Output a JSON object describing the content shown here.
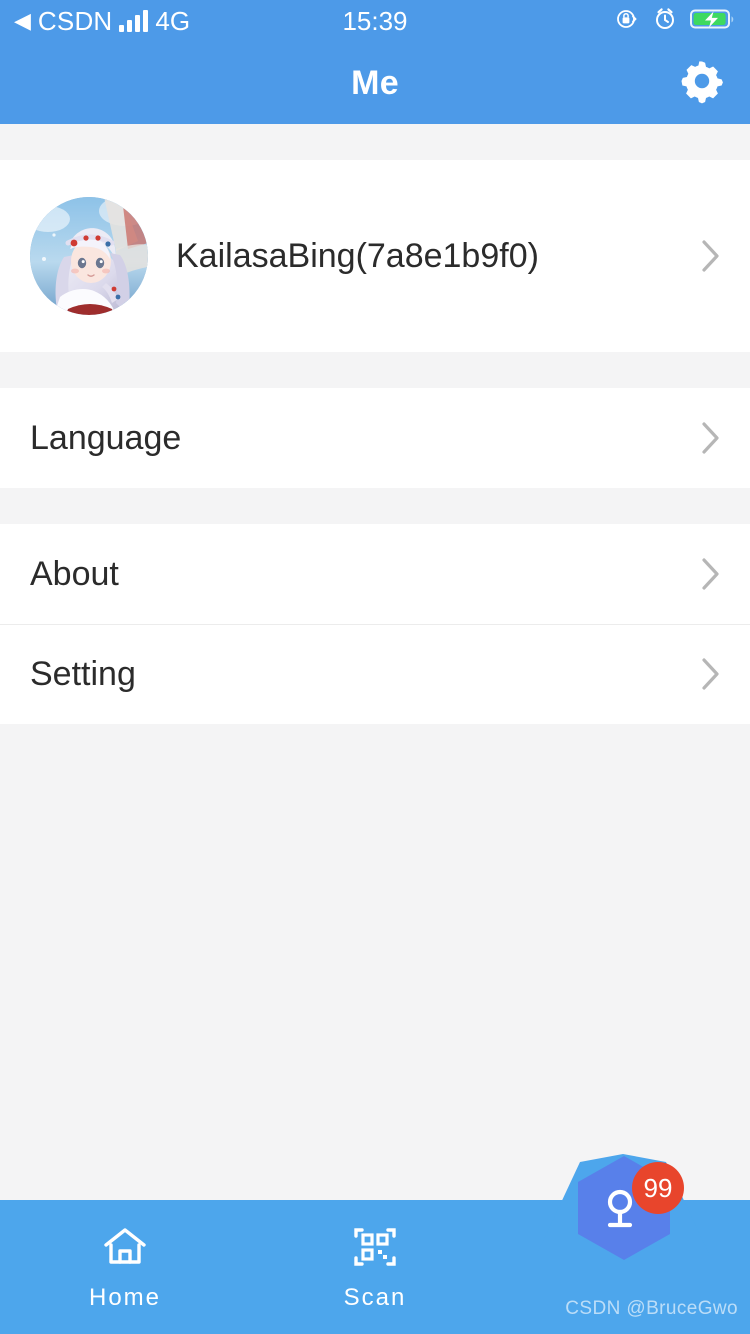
{
  "status_bar": {
    "back_indicator": "◀",
    "carrier": "CSDN",
    "signal_icon": "signal-bars-icon",
    "network": "4G",
    "time": "15:39",
    "rotation_lock_icon": "rotation-lock-icon",
    "alarm_icon": "alarm-clock-icon",
    "battery_icon": "battery-charging-icon",
    "colors": {
      "background": "#4d9ae8",
      "foreground": "#ffffff"
    }
  },
  "navbar": {
    "title": "Me",
    "settings_icon": "gear-icon",
    "background": "#4d9ae8"
  },
  "profile": {
    "avatar_icon": "user-avatar-anime",
    "name": "KailasaBing(7a8e1b9f0)",
    "chevron_icon": "chevron-right-icon"
  },
  "menu_groups": [
    {
      "items": [
        {
          "label": "Language",
          "chevron_icon": "chevron-right-icon"
        }
      ]
    },
    {
      "items": [
        {
          "label": "About",
          "chevron_icon": "chevron-right-icon"
        },
        {
          "label": "Setting",
          "chevron_icon": "chevron-right-icon"
        }
      ]
    }
  ],
  "tabbar": {
    "background": "#4da6ec",
    "items": [
      {
        "label": "Home",
        "icon": "home-icon",
        "active": true
      },
      {
        "label": "Scan",
        "icon": "qr-scan-icon",
        "active": false
      }
    ],
    "fab": {
      "icon": "magnifier-flag-icon",
      "badge": "99",
      "hex_color": "#5880ea",
      "badge_color": "#e8452c"
    }
  },
  "watermark": "CSDN @BruceGwo",
  "theme": {
    "primary": "#4d9ae8",
    "tabbar": "#4da6ec",
    "page_background": "#f4f4f5",
    "card_background": "#ffffff",
    "text_primary": "#2b2b2b",
    "chevron": "#b6b6b6"
  }
}
